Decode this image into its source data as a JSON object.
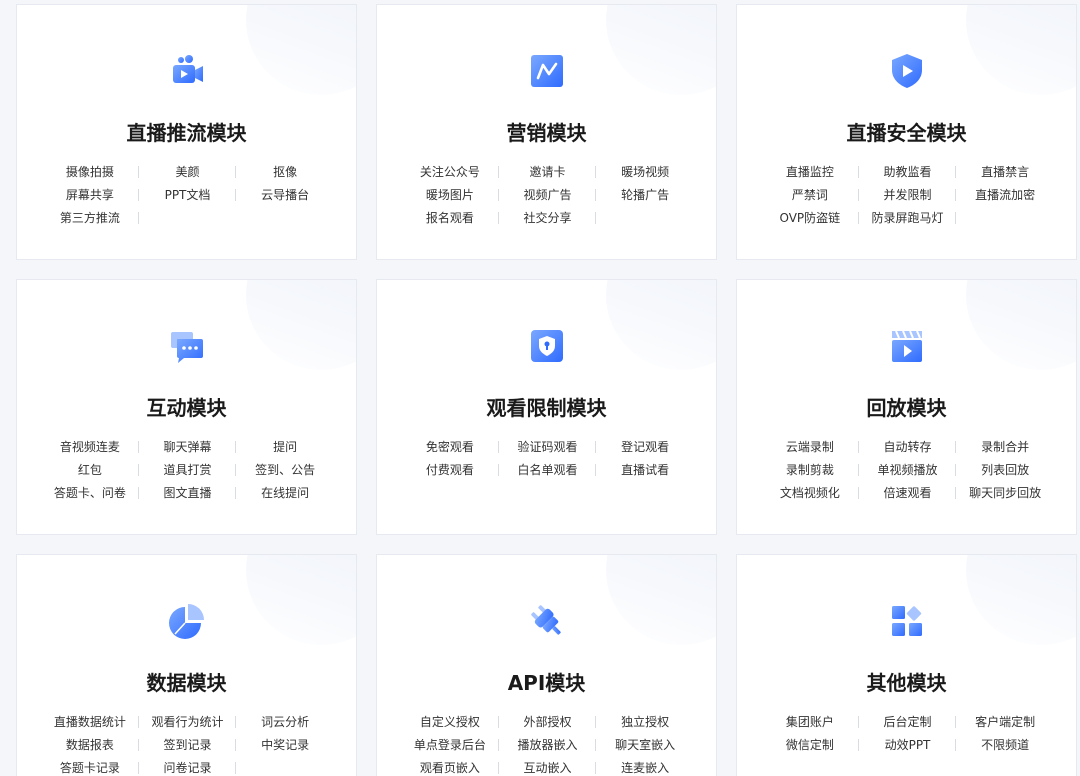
{
  "colors": {
    "accent": "#2f6bff",
    "accent_light": "#7aa8ff"
  },
  "cards": [
    {
      "title": "直播推流模块",
      "icon": "video-camera-icon",
      "features": [
        "摄像拍摄",
        "美颜",
        "抠像",
        "屏幕共享",
        "PPT文档",
        "云导播台",
        "第三方推流"
      ]
    },
    {
      "title": "营销模块",
      "icon": "trend-chart-icon",
      "features": [
        "关注公众号",
        "邀请卡",
        "暖场视频",
        "暖场图片",
        "视频广告",
        "轮播广告",
        "报名观看",
        "社交分享"
      ]
    },
    {
      "title": "直播安全模块",
      "icon": "shield-play-icon",
      "features": [
        "直播监控",
        "助教监看",
        "直播禁言",
        "严禁词",
        "并发限制",
        "直播流加密",
        "OVP防盗链",
        "防录屏跑马灯"
      ]
    },
    {
      "title": "互动模块",
      "icon": "chat-bubble-icon",
      "features": [
        "音视频连麦",
        "聊天弹幕",
        "提问",
        "红包",
        "道具打赏",
        "签到、公告",
        "答题卡、问卷",
        "图文直播",
        "在线提问"
      ]
    },
    {
      "title": "观看限制模块",
      "icon": "lock-shield-icon",
      "features": [
        "免密观看",
        "验证码观看",
        "登记观看",
        "付费观看",
        "白名单观看",
        "直播试看"
      ]
    },
    {
      "title": "回放模块",
      "icon": "clapperboard-icon",
      "features": [
        "云端录制",
        "自动转存",
        "录制合并",
        "录制剪裁",
        "单视频播放",
        "列表回放",
        "文档视频化",
        "倍速观看",
        "聊天同步回放"
      ]
    },
    {
      "title": "数据模块",
      "icon": "pie-chart-icon",
      "features": [
        "直播数据统计",
        "观看行为统计",
        "词云分析",
        "数据报表",
        "签到记录",
        "中奖记录",
        "答题卡记录",
        "问卷记录"
      ]
    },
    {
      "title": "API模块",
      "icon": "plug-icon",
      "features": [
        "自定义授权",
        "外部授权",
        "独立授权",
        "单点登录后台",
        "播放器嵌入",
        "聊天室嵌入",
        "观看页嵌入",
        "互动嵌入",
        "连麦嵌入"
      ]
    },
    {
      "title": "其他模块",
      "icon": "grid-apps-icon",
      "features": [
        "集团账户",
        "后台定制",
        "客户端定制",
        "微信定制",
        "动效PPT",
        "不限频道"
      ]
    }
  ]
}
